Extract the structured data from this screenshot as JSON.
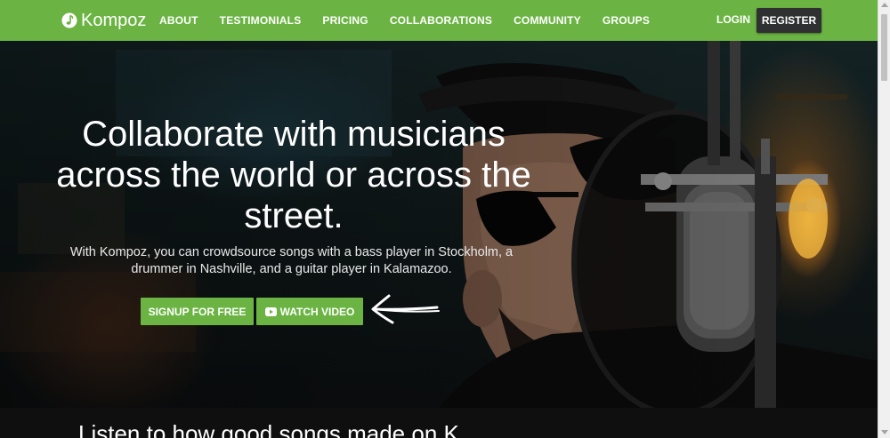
{
  "brand": {
    "name": "Kompoz",
    "icon": "note-icon",
    "color": "#6bb443"
  },
  "nav": {
    "links": [
      "ABOUT",
      "TESTIMONIALS",
      "PRICING",
      "COLLABORATIONS",
      "COMMUNITY",
      "GROUPS"
    ],
    "login_label": "LOGIN",
    "register_label": "REGISTER"
  },
  "hero": {
    "headline": "Collaborate with musicians across the world or across the street.",
    "subtext": "With Kompoz, you can crowdsource songs with a bass player in Stockholm, a drummer in Nashville, and a guitar player in Kalamazoo.",
    "signup_label": "SIGNUP FOR FREE",
    "video_label": "WATCH VIDEO",
    "video_icon": "youtube-play-icon"
  },
  "next_section": {
    "heading_partial": "Listen to how good songs made on K"
  },
  "colors": {
    "accent": "#6bb443",
    "register_bg": "#2f3032"
  }
}
